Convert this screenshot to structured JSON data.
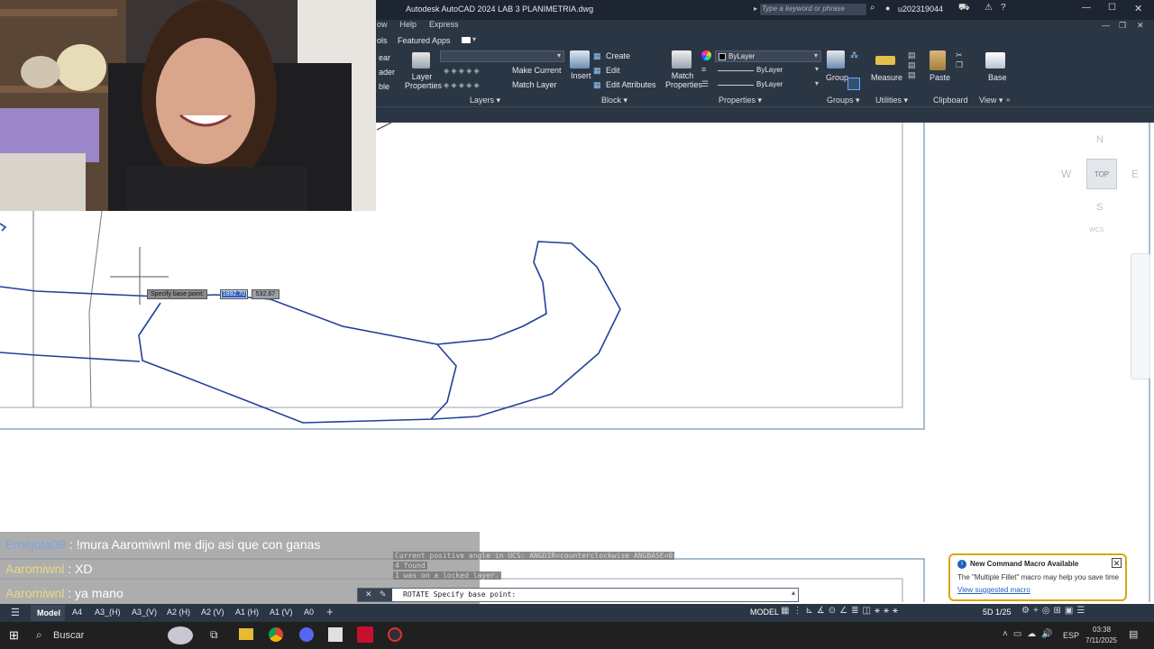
{
  "app": {
    "title": "Autodesk AutoCAD 2024   LAB 3 PLANIMETRIA.dwg",
    "search_placeholder": "Type a keyword or phrase",
    "user": "u202319044"
  },
  "ribbon": {
    "tabs": [
      "ow",
      "Help",
      "Express"
    ],
    "subtabs": [
      "ols",
      "Featured Apps"
    ],
    "layers": {
      "layer_properties_label": "Layer Properties",
      "make_current": "Make Current",
      "match_layer": "Match Layer",
      "panel_label": "Layers ▾"
    },
    "block": {
      "insert_label": "Insert",
      "create": "Create",
      "edit": "Edit",
      "edit_attributes": "Edit Attributes",
      "panel_label": "Block ▾"
    },
    "properties": {
      "match_label": "Match Properties",
      "color": "ByLayer",
      "linetype": "ByLayer",
      "lineweight": "ByLayer",
      "panel_label": "Properties ▾"
    },
    "groups": {
      "group_label": "Group",
      "panel_label": "Groups ▾"
    },
    "utilities": {
      "measure_label": "Measure",
      "panel_label": "Utilities ▾"
    },
    "clipboard": {
      "paste_label": "Paste",
      "panel_label": "Clipboard"
    },
    "view": {
      "base_label": "Base",
      "panel_label": "View ▾"
    },
    "left_cut": [
      "ear",
      "ader",
      "ble"
    ]
  },
  "viewcube": {
    "n": "N",
    "s": "S",
    "e": "E",
    "w": "W",
    "top": "TOP",
    "wcs": "WCS"
  },
  "dynamic_input": {
    "prompt": "Specify base point:",
    "x": "1892.70",
    "y": "532.67"
  },
  "chat": [
    {
      "user": "Emejota09",
      "sep": " : ",
      "msg": "!mura Aaromiwnl me dijo asi que con ganas"
    },
    {
      "user": "Aaromiwnl",
      "sep": " : ",
      "msg": "XD"
    },
    {
      "user": "Aaromiwnl",
      "sep": " : ",
      "msg": "ya mano"
    }
  ],
  "command_history": [
    "Current positive angle in UCS:  ANGDIR=counterclockwise  ANGBASE=0",
    "4 found",
    "1 was on a locked layer."
  ],
  "command_line": "ROTATE Specify base point:",
  "notification": {
    "title": "New Command Macro Available",
    "body": "The \"Multiple Fillet\" macro may help you save time",
    "link": "View suggested macro"
  },
  "layout_tabs": [
    "Model",
    "A4",
    "A3_(H)",
    "A3_(V)",
    "A2 (H)",
    "A2 (V)",
    "A1 (H)",
    "A1 (V)",
    "A0"
  ],
  "status": {
    "model": "MODEL",
    "scale": "5D 1/25"
  },
  "taskbar": {
    "search": "Buscar",
    "lang": "ESP",
    "time": "03:38",
    "date": "7/11/2025"
  }
}
